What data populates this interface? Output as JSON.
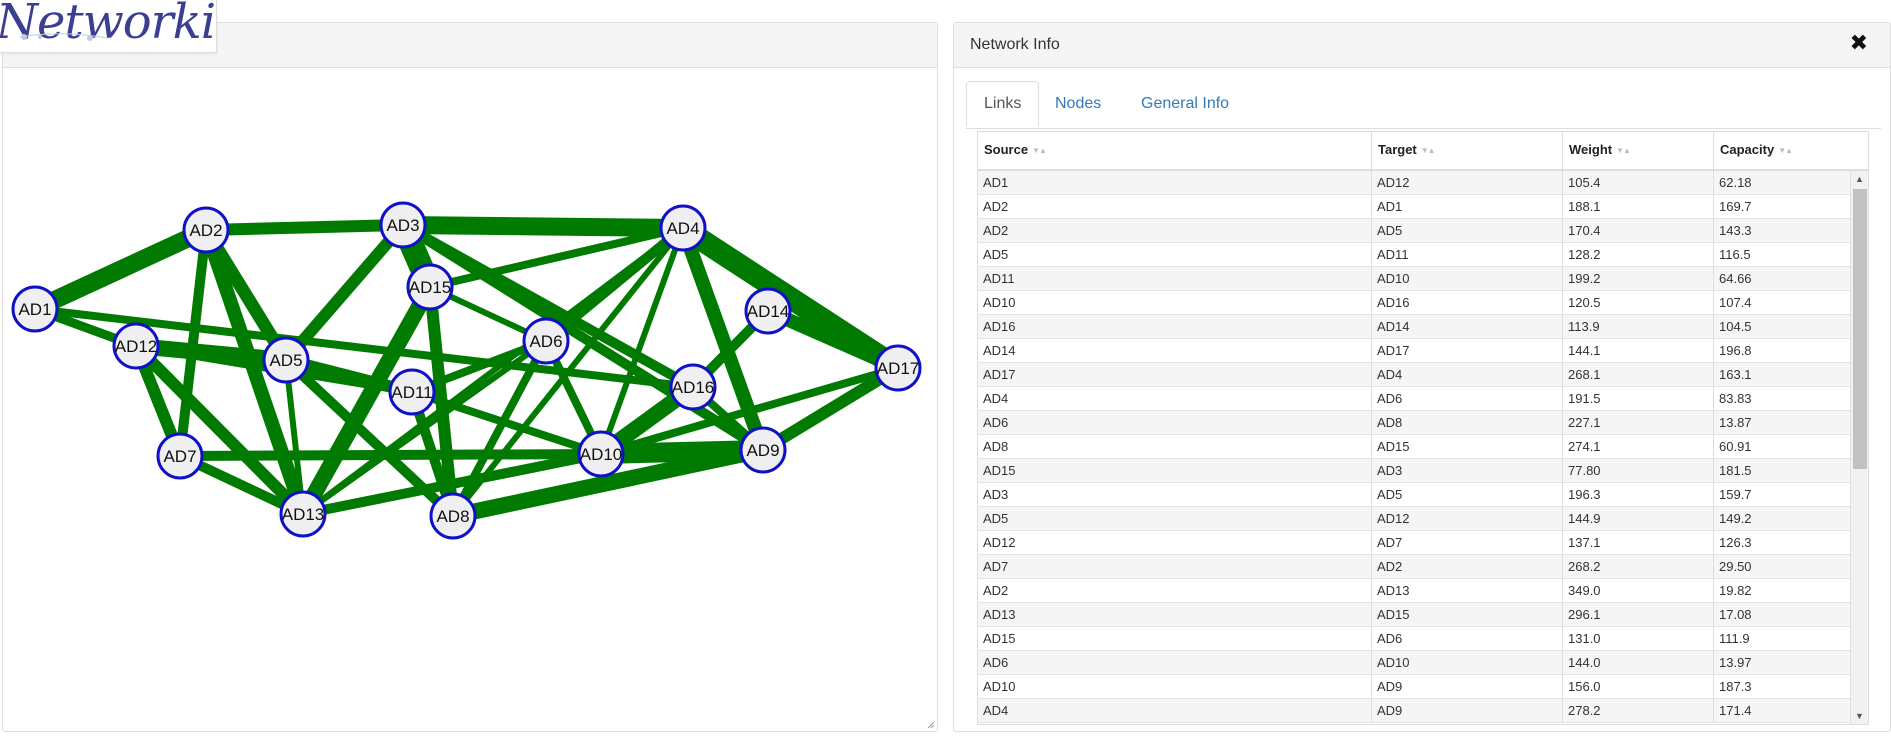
{
  "logo": {
    "text": "Networking"
  },
  "info_panel": {
    "title": "Network Info",
    "close_label": "✖",
    "tabs": [
      {
        "label": "Links",
        "active": true
      },
      {
        "label": "Nodes",
        "active": false
      },
      {
        "label": "General Info",
        "active": false
      }
    ],
    "table": {
      "columns": [
        "Source",
        "Target",
        "Weight",
        "Capacity"
      ],
      "rows": [
        [
          "AD1",
          "AD12",
          "105.4",
          "62.18"
        ],
        [
          "AD2",
          "AD1",
          "188.1",
          "169.7"
        ],
        [
          "AD2",
          "AD5",
          "170.4",
          "143.3"
        ],
        [
          "AD5",
          "AD11",
          "128.2",
          "116.5"
        ],
        [
          "AD11",
          "AD10",
          "199.2",
          "64.66"
        ],
        [
          "AD10",
          "AD16",
          "120.5",
          "107.4"
        ],
        [
          "AD16",
          "AD14",
          "113.9",
          "104.5"
        ],
        [
          "AD14",
          "AD17",
          "144.1",
          "196.8"
        ],
        [
          "AD17",
          "AD4",
          "268.1",
          "163.1"
        ],
        [
          "AD4",
          "AD6",
          "191.5",
          "83.83"
        ],
        [
          "AD6",
          "AD8",
          "227.1",
          "13.87"
        ],
        [
          "AD8",
          "AD15",
          "274.1",
          "60.91"
        ],
        [
          "AD15",
          "AD3",
          "77.80",
          "181.5"
        ],
        [
          "AD3",
          "AD5",
          "196.3",
          "159.7"
        ],
        [
          "AD5",
          "AD12",
          "144.9",
          "149.2"
        ],
        [
          "AD12",
          "AD7",
          "137.1",
          "126.3"
        ],
        [
          "AD7",
          "AD2",
          "268.2",
          "29.50"
        ],
        [
          "AD2",
          "AD13",
          "349.0",
          "19.82"
        ],
        [
          "AD13",
          "AD15",
          "296.1",
          "17.08"
        ],
        [
          "AD15",
          "AD6",
          "131.0",
          "111.9"
        ],
        [
          "AD6",
          "AD10",
          "144.0",
          "13.97"
        ],
        [
          "AD10",
          "AD9",
          "156.0",
          "187.3"
        ],
        [
          "AD4",
          "AD9",
          "278.2",
          "171.4"
        ]
      ]
    }
  },
  "graph": {
    "node_fill": "#efeff1",
    "node_stroke": "#1010c8",
    "edge_color": "#007a00",
    "nodes": [
      "AD1",
      "AD2",
      "AD3",
      "AD4",
      "AD5",
      "AD6",
      "AD7",
      "AD8",
      "AD9",
      "AD10",
      "AD11",
      "AD12",
      "AD13",
      "AD14",
      "AD15",
      "AD16",
      "AD17"
    ],
    "edges": [
      [
        "AD1",
        "AD12"
      ],
      [
        "AD2",
        "AD1"
      ],
      [
        "AD2",
        "AD5"
      ],
      [
        "AD5",
        "AD11"
      ],
      [
        "AD11",
        "AD10"
      ],
      [
        "AD10",
        "AD16"
      ],
      [
        "AD16",
        "AD14"
      ],
      [
        "AD14",
        "AD17"
      ],
      [
        "AD17",
        "AD4"
      ],
      [
        "AD4",
        "AD6"
      ],
      [
        "AD6",
        "AD8"
      ],
      [
        "AD8",
        "AD15"
      ],
      [
        "AD15",
        "AD3"
      ],
      [
        "AD3",
        "AD5"
      ],
      [
        "AD5",
        "AD12"
      ],
      [
        "AD12",
        "AD7"
      ],
      [
        "AD7",
        "AD2"
      ],
      [
        "AD2",
        "AD13"
      ],
      [
        "AD13",
        "AD15"
      ],
      [
        "AD15",
        "AD6"
      ],
      [
        "AD6",
        "AD10"
      ],
      [
        "AD10",
        "AD9"
      ],
      [
        "AD4",
        "AD9"
      ],
      [
        "AD2",
        "AD3"
      ],
      [
        "AD3",
        "AD4"
      ],
      [
        "AD3",
        "AD16"
      ],
      [
        "AD4",
        "AD15"
      ],
      [
        "AD4",
        "AD10"
      ],
      [
        "AD1",
        "AD16"
      ],
      [
        "AD12",
        "AD13"
      ],
      [
        "AD7",
        "AD10"
      ],
      [
        "AD13",
        "AD10"
      ],
      [
        "AD8",
        "AD9"
      ],
      [
        "AD9",
        "AD17"
      ],
      [
        "AD16",
        "AD9"
      ],
      [
        "AD5",
        "AD8"
      ],
      [
        "AD12",
        "AD11"
      ],
      [
        "AD11",
        "AD6"
      ],
      [
        "AD13",
        "AD4"
      ],
      [
        "AD5",
        "AD13"
      ],
      [
        "AD11",
        "AD8"
      ],
      [
        "AD8",
        "AD4"
      ],
      [
        "AD10",
        "AD17"
      ],
      [
        "AD3",
        "AD9"
      ],
      [
        "AD7",
        "AD13"
      ],
      [
        "AD6",
        "AD13"
      ]
    ]
  }
}
